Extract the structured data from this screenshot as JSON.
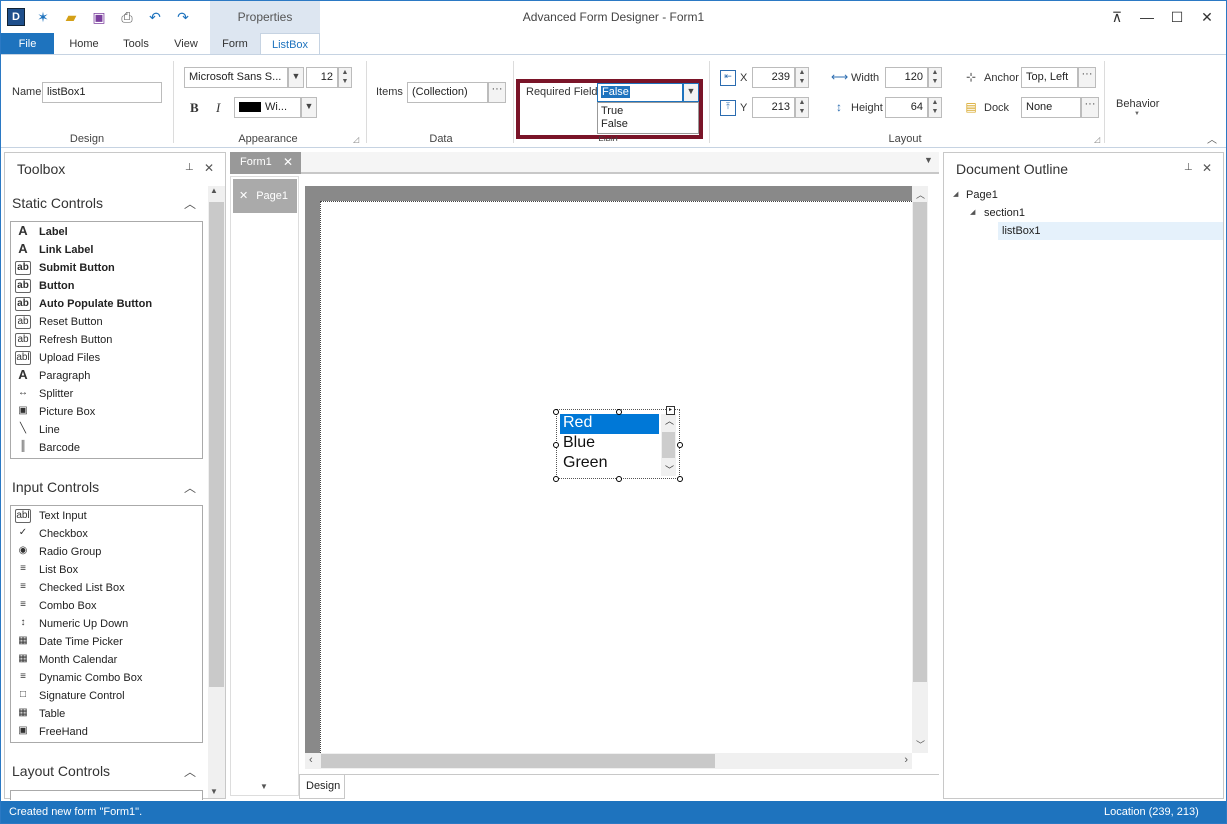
{
  "window": {
    "title": "Advanced Form Designer - Form1",
    "context_tab_group": "Properties"
  },
  "tabs": [
    "File",
    "Home",
    "Tools",
    "View",
    "Form",
    "ListBox"
  ],
  "ribbon": {
    "design": {
      "name_label": "Name",
      "name_value": "listBox1",
      "group": "Design"
    },
    "appearance": {
      "font_name": "Microsoft Sans S...",
      "font_size": "12",
      "color_label": "Wi...",
      "group": "Appearance"
    },
    "data": {
      "items_label": "Items",
      "items_value": "(Collection)",
      "group": "Data"
    },
    "field": {
      "required_label": "Required Field",
      "required_value": "False",
      "options": [
        "True",
        "False"
      ],
      "group": "Field"
    },
    "layout": {
      "x_label": "X",
      "x_value": "239",
      "y_label": "Y",
      "y_value": "213",
      "width_label": "Width",
      "width_value": "120",
      "height_label": "Height",
      "height_value": "64",
      "anchor_label": "Anchor",
      "anchor_value": "Top, Left",
      "dock_label": "Dock",
      "dock_value": "None",
      "group": "Layout"
    },
    "behavior": {
      "label": "Behavior"
    }
  },
  "toolbox": {
    "title": "Toolbox",
    "static_title": "Static Controls",
    "static": [
      {
        "label": "Label",
        "icon": "A",
        "bold": true
      },
      {
        "label": "Link Label",
        "icon": "A",
        "bold": true
      },
      {
        "label": "Submit Button",
        "icon": "ab",
        "bold": true
      },
      {
        "label": "Button",
        "icon": "ab",
        "bold": true
      },
      {
        "label": "Auto Populate Button",
        "icon": "ab",
        "bold": true
      },
      {
        "label": "Reset Button",
        "icon": "ab",
        "bold": false
      },
      {
        "label": "Refresh Button",
        "icon": "ab",
        "bold": false
      },
      {
        "label": "Upload Files",
        "icon": "abl",
        "bold": false
      },
      {
        "label": "Paragraph",
        "icon": "A",
        "bold": false
      },
      {
        "label": "Splitter",
        "icon": "↔",
        "bold": false
      },
      {
        "label": "Picture Box",
        "icon": "▣",
        "bold": false
      },
      {
        "label": "Line",
        "icon": "╲",
        "bold": false
      },
      {
        "label": "Barcode",
        "icon": "║",
        "bold": false
      }
    ],
    "input_title": "Input Controls",
    "input": [
      {
        "label": "Text Input",
        "icon": "abl"
      },
      {
        "label": "Checkbox",
        "icon": "✓"
      },
      {
        "label": "Radio Group",
        "icon": "◉"
      },
      {
        "label": "List Box",
        "icon": "≡"
      },
      {
        "label": "Checked List Box",
        "icon": "≡"
      },
      {
        "label": "Combo Box",
        "icon": "≡"
      },
      {
        "label": "Numeric Up Down",
        "icon": "↕"
      },
      {
        "label": "Date Time Picker",
        "icon": "▦"
      },
      {
        "label": "Month Calendar",
        "icon": "▦"
      },
      {
        "label": "Dynamic Combo Box",
        "icon": "≡"
      },
      {
        "label": "Signature Control",
        "icon": "□"
      },
      {
        "label": "Table",
        "icon": "▦"
      },
      {
        "label": "FreeHand",
        "icon": "▣"
      }
    ],
    "layout_title": "Layout Controls"
  },
  "document": {
    "tab": "Form1",
    "page_tab": "Page1",
    "bottom_tab": "Design",
    "listbox_items": [
      "Red",
      "Blue",
      "Green"
    ]
  },
  "outline": {
    "title": "Document Outline",
    "nodes": [
      "Page1",
      "section1",
      "listBox1"
    ]
  },
  "status": {
    "left": "Created new form \"Form1\".",
    "right": "Location (239, 213)"
  },
  "colors": {
    "accent": "#1e73be",
    "highlight_border": "#7a1428"
  }
}
